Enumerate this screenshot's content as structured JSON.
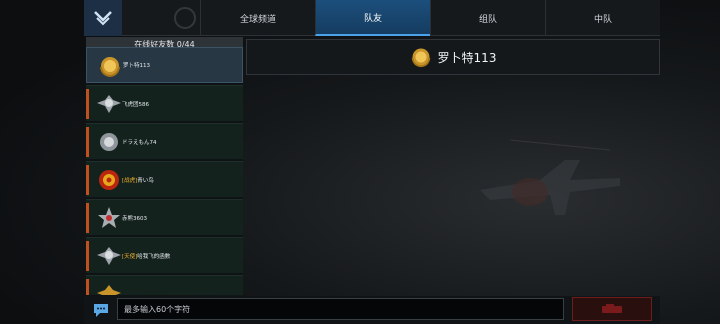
{
  "tabs": [
    {
      "label": "全球频道",
      "active": false
    },
    {
      "label": "队友",
      "active": true
    },
    {
      "label": "组队",
      "active": false
    },
    {
      "label": "中队",
      "active": false
    }
  ],
  "friends_panel": {
    "header": "在线好友数 0/44",
    "items": [
      {
        "name": "罗卜特113",
        "tag": "",
        "badge": "gold-wreath-badge",
        "selected": true
      },
      {
        "name": "飞虎团586",
        "tag": "",
        "badge": "silver-wings-badge",
        "selected": false
      },
      {
        "name": "ドラえもん74",
        "tag": "",
        "badge": "silver-medal-badge",
        "selected": false
      },
      {
        "name": "青い鸟",
        "tag": "[战虎]",
        "badge": "red-gold-emblem-badge",
        "selected": false
      },
      {
        "name": "赤熊3603",
        "tag": "",
        "badge": "silver-star-badge",
        "selected": false
      },
      {
        "name": "哈我飞的函數",
        "tag": "[天使]",
        "badge": "silver-wings-badge",
        "selected": false
      }
    ]
  },
  "detail": {
    "name": "罗卜特113",
    "badge": "gold-wreath-badge"
  },
  "chat": {
    "placeholder": "最多输入60个字符"
  },
  "colors": {
    "accent_blue": "#1c4f7c",
    "accent_orange": "#c2501e",
    "send_red": "#6e1d1d",
    "gold": "#f0b428"
  }
}
